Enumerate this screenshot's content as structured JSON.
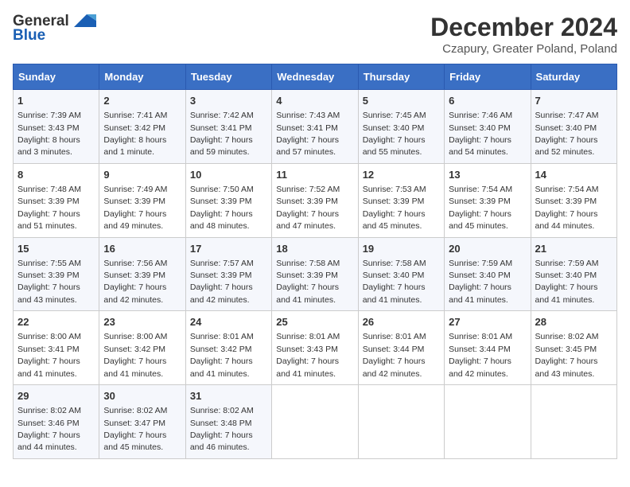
{
  "header": {
    "logo_line1": "General",
    "logo_line2": "Blue",
    "title": "December 2024",
    "subtitle": "Czapury, Greater Poland, Poland"
  },
  "columns": [
    "Sunday",
    "Monday",
    "Tuesday",
    "Wednesday",
    "Thursday",
    "Friday",
    "Saturday"
  ],
  "weeks": [
    [
      {
        "day": "1",
        "sunrise": "Sunrise: 7:39 AM",
        "sunset": "Sunset: 3:43 PM",
        "daylight": "Daylight: 8 hours and 3 minutes."
      },
      {
        "day": "2",
        "sunrise": "Sunrise: 7:41 AM",
        "sunset": "Sunset: 3:42 PM",
        "daylight": "Daylight: 8 hours and 1 minute."
      },
      {
        "day": "3",
        "sunrise": "Sunrise: 7:42 AM",
        "sunset": "Sunset: 3:41 PM",
        "daylight": "Daylight: 7 hours and 59 minutes."
      },
      {
        "day": "4",
        "sunrise": "Sunrise: 7:43 AM",
        "sunset": "Sunset: 3:41 PM",
        "daylight": "Daylight: 7 hours and 57 minutes."
      },
      {
        "day": "5",
        "sunrise": "Sunrise: 7:45 AM",
        "sunset": "Sunset: 3:40 PM",
        "daylight": "Daylight: 7 hours and 55 minutes."
      },
      {
        "day": "6",
        "sunrise": "Sunrise: 7:46 AM",
        "sunset": "Sunset: 3:40 PM",
        "daylight": "Daylight: 7 hours and 54 minutes."
      },
      {
        "day": "7",
        "sunrise": "Sunrise: 7:47 AM",
        "sunset": "Sunset: 3:40 PM",
        "daylight": "Daylight: 7 hours and 52 minutes."
      }
    ],
    [
      {
        "day": "8",
        "sunrise": "Sunrise: 7:48 AM",
        "sunset": "Sunset: 3:39 PM",
        "daylight": "Daylight: 7 hours and 51 minutes."
      },
      {
        "day": "9",
        "sunrise": "Sunrise: 7:49 AM",
        "sunset": "Sunset: 3:39 PM",
        "daylight": "Daylight: 7 hours and 49 minutes."
      },
      {
        "day": "10",
        "sunrise": "Sunrise: 7:50 AM",
        "sunset": "Sunset: 3:39 PM",
        "daylight": "Daylight: 7 hours and 48 minutes."
      },
      {
        "day": "11",
        "sunrise": "Sunrise: 7:52 AM",
        "sunset": "Sunset: 3:39 PM",
        "daylight": "Daylight: 7 hours and 47 minutes."
      },
      {
        "day": "12",
        "sunrise": "Sunrise: 7:53 AM",
        "sunset": "Sunset: 3:39 PM",
        "daylight": "Daylight: 7 hours and 45 minutes."
      },
      {
        "day": "13",
        "sunrise": "Sunrise: 7:54 AM",
        "sunset": "Sunset: 3:39 PM",
        "daylight": "Daylight: 7 hours and 45 minutes."
      },
      {
        "day": "14",
        "sunrise": "Sunrise: 7:54 AM",
        "sunset": "Sunset: 3:39 PM",
        "daylight": "Daylight: 7 hours and 44 minutes."
      }
    ],
    [
      {
        "day": "15",
        "sunrise": "Sunrise: 7:55 AM",
        "sunset": "Sunset: 3:39 PM",
        "daylight": "Daylight: 7 hours and 43 minutes."
      },
      {
        "day": "16",
        "sunrise": "Sunrise: 7:56 AM",
        "sunset": "Sunset: 3:39 PM",
        "daylight": "Daylight: 7 hours and 42 minutes."
      },
      {
        "day": "17",
        "sunrise": "Sunrise: 7:57 AM",
        "sunset": "Sunset: 3:39 PM",
        "daylight": "Daylight: 7 hours and 42 minutes."
      },
      {
        "day": "18",
        "sunrise": "Sunrise: 7:58 AM",
        "sunset": "Sunset: 3:39 PM",
        "daylight": "Daylight: 7 hours and 41 minutes."
      },
      {
        "day": "19",
        "sunrise": "Sunrise: 7:58 AM",
        "sunset": "Sunset: 3:40 PM",
        "daylight": "Daylight: 7 hours and 41 minutes."
      },
      {
        "day": "20",
        "sunrise": "Sunrise: 7:59 AM",
        "sunset": "Sunset: 3:40 PM",
        "daylight": "Daylight: 7 hours and 41 minutes."
      },
      {
        "day": "21",
        "sunrise": "Sunrise: 7:59 AM",
        "sunset": "Sunset: 3:40 PM",
        "daylight": "Daylight: 7 hours and 41 minutes."
      }
    ],
    [
      {
        "day": "22",
        "sunrise": "Sunrise: 8:00 AM",
        "sunset": "Sunset: 3:41 PM",
        "daylight": "Daylight: 7 hours and 41 minutes."
      },
      {
        "day": "23",
        "sunrise": "Sunrise: 8:00 AM",
        "sunset": "Sunset: 3:42 PM",
        "daylight": "Daylight: 7 hours and 41 minutes."
      },
      {
        "day": "24",
        "sunrise": "Sunrise: 8:01 AM",
        "sunset": "Sunset: 3:42 PM",
        "daylight": "Daylight: 7 hours and 41 minutes."
      },
      {
        "day": "25",
        "sunrise": "Sunrise: 8:01 AM",
        "sunset": "Sunset: 3:43 PM",
        "daylight": "Daylight: 7 hours and 41 minutes."
      },
      {
        "day": "26",
        "sunrise": "Sunrise: 8:01 AM",
        "sunset": "Sunset: 3:44 PM",
        "daylight": "Daylight: 7 hours and 42 minutes."
      },
      {
        "day": "27",
        "sunrise": "Sunrise: 8:01 AM",
        "sunset": "Sunset: 3:44 PM",
        "daylight": "Daylight: 7 hours and 42 minutes."
      },
      {
        "day": "28",
        "sunrise": "Sunrise: 8:02 AM",
        "sunset": "Sunset: 3:45 PM",
        "daylight": "Daylight: 7 hours and 43 minutes."
      }
    ],
    [
      {
        "day": "29",
        "sunrise": "Sunrise: 8:02 AM",
        "sunset": "Sunset: 3:46 PM",
        "daylight": "Daylight: 7 hours and 44 minutes."
      },
      {
        "day": "30",
        "sunrise": "Sunrise: 8:02 AM",
        "sunset": "Sunset: 3:47 PM",
        "daylight": "Daylight: 7 hours and 45 minutes."
      },
      {
        "day": "31",
        "sunrise": "Sunrise: 8:02 AM",
        "sunset": "Sunset: 3:48 PM",
        "daylight": "Daylight: 7 hours and 46 minutes."
      },
      null,
      null,
      null,
      null
    ]
  ]
}
